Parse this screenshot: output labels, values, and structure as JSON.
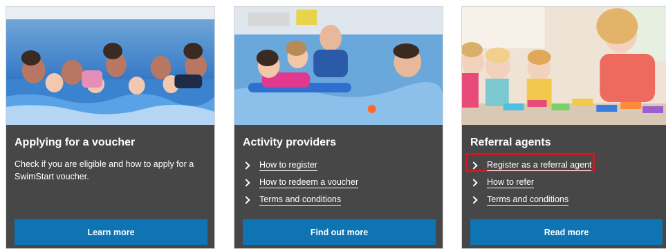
{
  "cards": [
    {
      "title": "Applying for a voucher",
      "description": "Check if you are eligible and how to apply for a SwimStart voucher.",
      "button": "Learn more"
    },
    {
      "title": "Activity providers",
      "links": [
        "How to register",
        "How to redeem a voucher",
        "Terms and conditions"
      ],
      "button": "Find out more"
    },
    {
      "title": "Referral agents",
      "links": [
        "Register as a referral agent",
        "How to refer",
        "Terms and conditions"
      ],
      "highlighted_link": "Register as a referral agent",
      "button": "Read more"
    }
  ],
  "icons": {
    "link_bullet": "chevron-right-icon"
  },
  "colors": {
    "card_background": "#474747",
    "button": "#0f74b3",
    "highlight_border": "#d0181f",
    "text": "#ffffff"
  }
}
